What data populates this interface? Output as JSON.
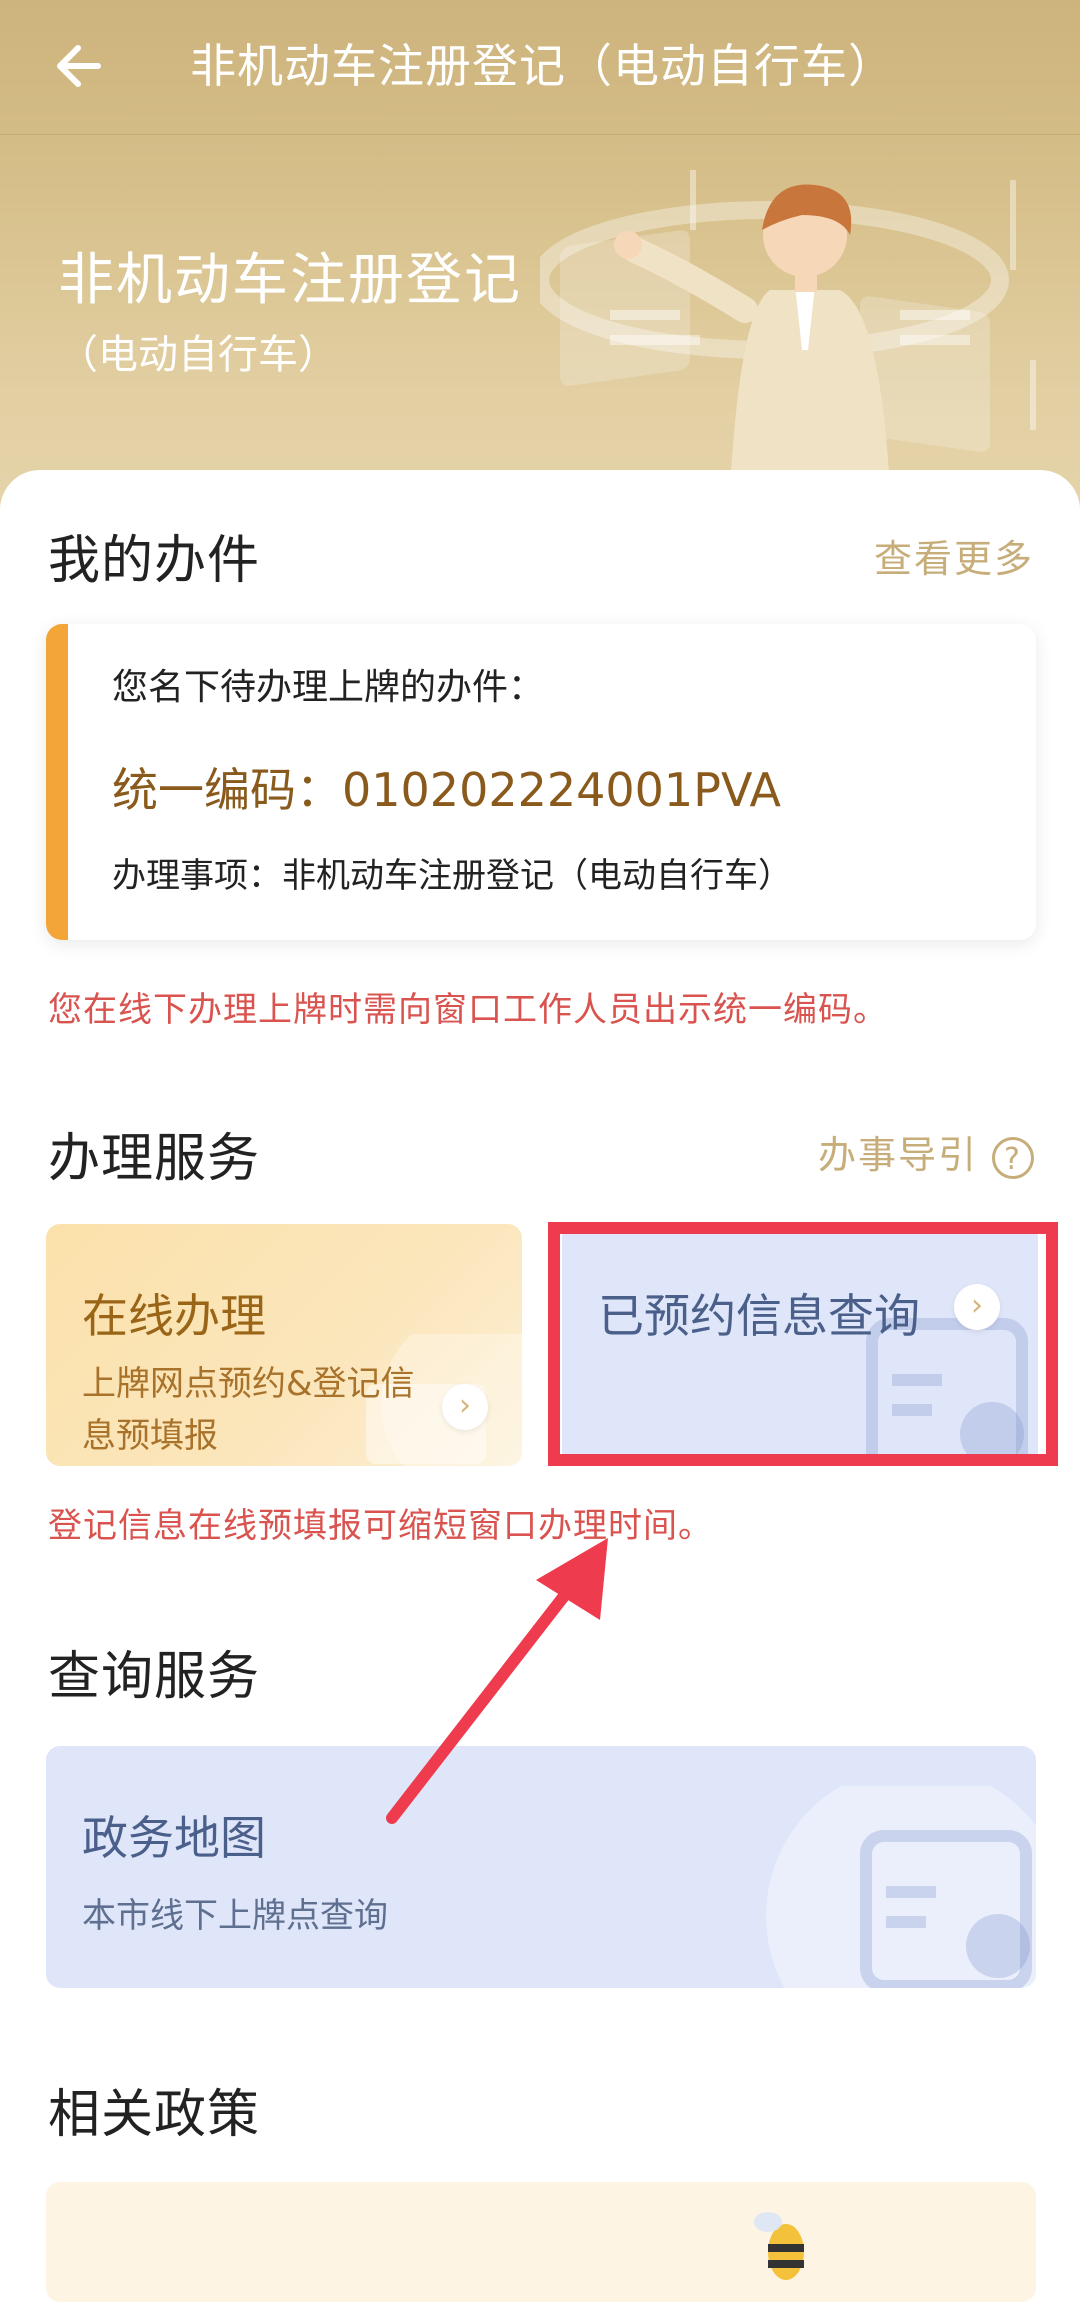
{
  "nav": {
    "title": "非机动车注册登记（电动自行车）"
  },
  "hero": {
    "title": "非机动车注册登记",
    "subtitle": "（电动自行车）"
  },
  "my_cases": {
    "title": "我的办件",
    "more": "查看更多",
    "intro": "您名下待办理上牌的办件：",
    "code_label": "统一编码：",
    "code_value": "010202224001PVA",
    "matter_label": "办理事项：",
    "matter_value": "非机动车注册登记（电动自行车）",
    "note": "您在线下办理上牌时需向窗口工作人员出示统一编码。"
  },
  "services": {
    "title": "办理服务",
    "guide": "办事导引",
    "online": {
      "title": "在线办理",
      "subtitle": "上牌网点预约&登记信息预填报"
    },
    "booked": {
      "title": "已预约信息查询"
    },
    "note": "登记信息在线预填报可缩短窗口办理时间。"
  },
  "query": {
    "title": "查询服务",
    "map": {
      "title": "政务地图",
      "subtitle": "本市线下上牌点查询"
    }
  },
  "policy": {
    "title": "相关政策"
  },
  "colors": {
    "hero": "#d7c08b",
    "accent_orange": "#f3a637",
    "note_red": "#d9534f",
    "highlight_red": "#ee3b4d",
    "link_gold": "#c7ad79"
  },
  "icons": [
    "back-arrow-icon",
    "help-icon",
    "chevron-right-icon",
    "calendar-clock-icon",
    "annotation-arrow"
  ]
}
